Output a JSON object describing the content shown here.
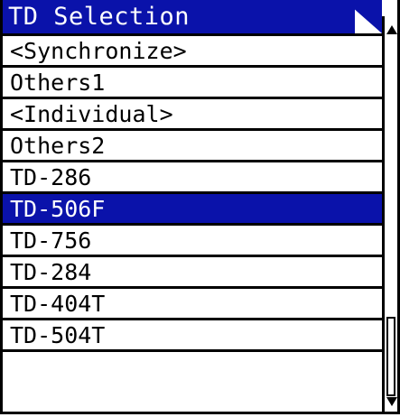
{
  "title": "TD Selection",
  "colors": {
    "title_background": "#0a12aa",
    "selected_background": "#0a12aa",
    "selected_text": "#ffffff"
  },
  "selected_index": 6,
  "items": [
    {
      "label": "<Synchronize>"
    },
    {
      "label": "Others1"
    },
    {
      "label": "<Individual>"
    },
    {
      "label": "Others2"
    },
    {
      "label": "TD-286"
    },
    {
      "label": "TD-506F"
    },
    {
      "label": "TD-756"
    },
    {
      "label": "TD-284"
    },
    {
      "label": "TD-404T"
    },
    {
      "label": "TD-504T"
    }
  ],
  "scrollbar": {
    "up_icon": "scroll-up-arrow-icon",
    "down_icon": "scroll-down-arrow-icon",
    "position": "bottom"
  }
}
